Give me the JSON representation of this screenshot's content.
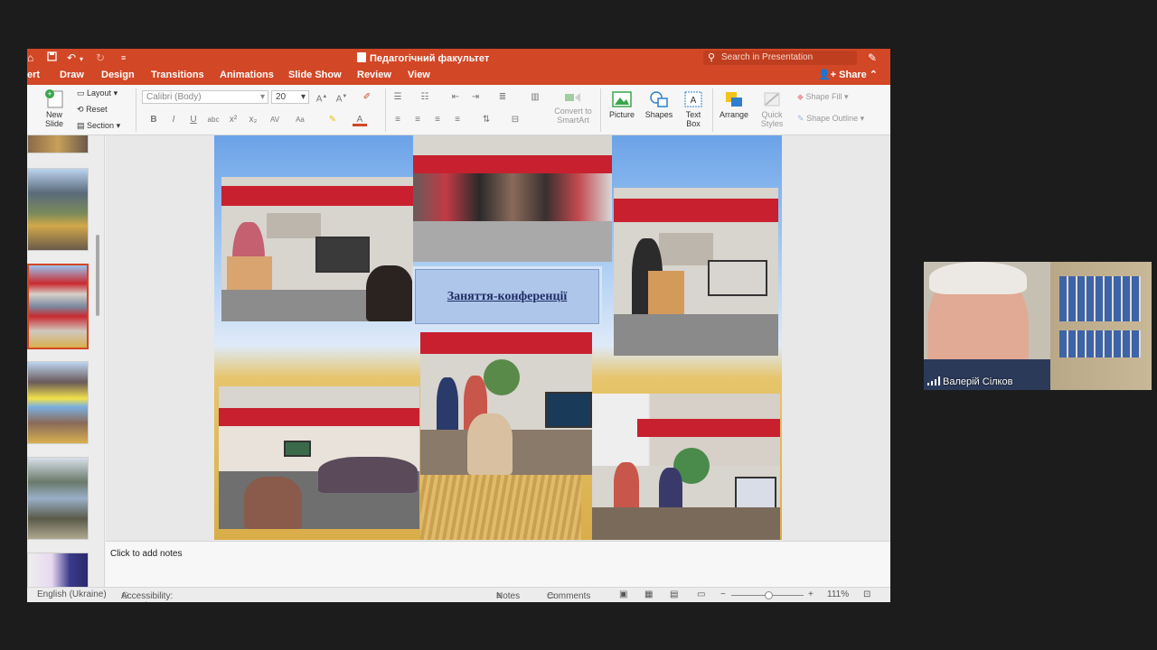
{
  "window": {
    "title": "Педагогічний факультет",
    "search_placeholder": "Search in Presentation",
    "share_label": "Share"
  },
  "tabs": [
    "ert",
    "Draw",
    "Design",
    "Transitions",
    "Animations",
    "Slide Show",
    "Review",
    "View"
  ],
  "ribbon": {
    "new_slide": "New Slide",
    "layout": "Layout",
    "reset": "Reset",
    "section": "Section",
    "font_name": "Calibri (Body)",
    "font_size": "20",
    "convert_smartart": "Convert to SmartArt",
    "picture": "Picture",
    "shapes": "Shapes",
    "text_box": "Text Box",
    "arrange": "Arrange",
    "quick_styles": "Quick Styles",
    "shape_fill": "Shape Fill",
    "shape_outline": "Shape Outline"
  },
  "slide": {
    "label": "Заняття-конференції"
  },
  "notes_placeholder": "Click to add notes",
  "status": {
    "language": "English (Ukraine)",
    "accessibility": "Accessibility: Investigate",
    "notes": "Notes",
    "comments": "Comments",
    "zoom": "111%"
  },
  "video": {
    "participant_name": "Валерій Сілков"
  },
  "colors": {
    "accent": "#d24726",
    "slide_label_bg": "#aec6e9",
    "slide_label_text": "#1f2c66"
  }
}
